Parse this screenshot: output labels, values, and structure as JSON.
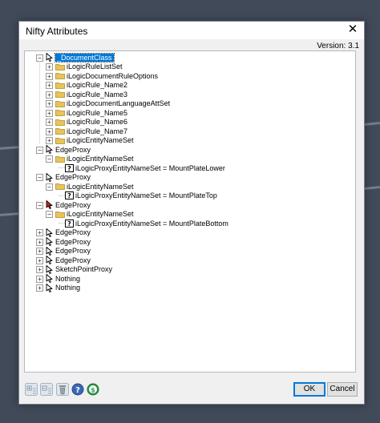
{
  "dialog": {
    "title": "Nifty Attributes",
    "close_symbol": "✕",
    "version": "Version: 3.1"
  },
  "tree": [
    {
      "level": 0,
      "expander": "−",
      "icon": "cursor-icon",
      "label": "_DocumentClass",
      "selected": true
    },
    {
      "level": 1,
      "expander": "+",
      "icon": "folder-icon",
      "label": "iLogicRuleListSet"
    },
    {
      "level": 1,
      "expander": "+",
      "icon": "folder-icon",
      "label": "iLogicDocumentRuleOptions"
    },
    {
      "level": 1,
      "expander": "+",
      "icon": "folder-icon",
      "label": "iLogicRule_Name2"
    },
    {
      "level": 1,
      "expander": "+",
      "icon": "folder-icon",
      "label": "iLogicRule_Name3"
    },
    {
      "level": 1,
      "expander": "+",
      "icon": "folder-icon",
      "label": "iLogicDocumentLanguageAttSet"
    },
    {
      "level": 1,
      "expander": "+",
      "icon": "folder-icon",
      "label": "iLogicRule_Name5"
    },
    {
      "level": 1,
      "expander": "+",
      "icon": "folder-icon",
      "label": "iLogicRule_Name6"
    },
    {
      "level": 1,
      "expander": "+",
      "icon": "folder-icon",
      "label": "iLogicRule_Name7"
    },
    {
      "level": 1,
      "expander": "+",
      "icon": "folder-icon",
      "label": "iLogicEntityNameSet"
    },
    {
      "level": 0,
      "expander": "−",
      "icon": "cursor-icon",
      "label": "EdgeProxy"
    },
    {
      "level": 1,
      "expander": "−",
      "icon": "folder-icon",
      "label": "iLogicEntityNameSet"
    },
    {
      "level": 2,
      "expander": "",
      "icon": "question-icon",
      "label": "iLogicProxyEntityNameSet = MountPlateLower"
    },
    {
      "level": 0,
      "expander": "−",
      "icon": "cursor-icon",
      "label": "EdgeProxy"
    },
    {
      "level": 1,
      "expander": "−",
      "icon": "folder-icon",
      "label": "iLogicEntityNameSet"
    },
    {
      "level": 2,
      "expander": "",
      "icon": "question-icon",
      "label": "iLogicProxyEntityNameSet = MountPlateTop"
    },
    {
      "level": 0,
      "expander": "−",
      "icon": "cursor-red-icon",
      "label": "EdgeProxy"
    },
    {
      "level": 1,
      "expander": "−",
      "icon": "folder-icon",
      "label": "iLogicEntityNameSet"
    },
    {
      "level": 2,
      "expander": "",
      "icon": "question-icon",
      "label": "iLogicProxyEntityNameSet = MountPlateBottom"
    },
    {
      "level": 0,
      "expander": "+",
      "icon": "cursor-icon",
      "label": "EdgeProxy"
    },
    {
      "level": 0,
      "expander": "+",
      "icon": "cursor-icon",
      "label": "EdgeProxy"
    },
    {
      "level": 0,
      "expander": "+",
      "icon": "cursor-icon",
      "label": "EdgeProxy"
    },
    {
      "level": 0,
      "expander": "+",
      "icon": "cursor-icon",
      "label": "EdgeProxy"
    },
    {
      "level": 0,
      "expander": "+",
      "icon": "cursor-icon",
      "label": "SketchPointProxy"
    },
    {
      "level": 0,
      "expander": "+",
      "icon": "cursor-icon",
      "label": "Nothing"
    },
    {
      "level": 0,
      "expander": "+",
      "icon": "cursor-icon",
      "label": "Nothing"
    }
  ],
  "toolbar": [
    {
      "name": "expand-all-icon"
    },
    {
      "name": "collapse-all-icon"
    },
    {
      "name": "delete-icon"
    },
    {
      "name": "help-icon"
    },
    {
      "name": "donate-icon"
    }
  ],
  "buttons": {
    "ok": "OK",
    "cancel": "Cancel"
  },
  "colors": {
    "selection": "#0078d7",
    "folder": "#e8c45a",
    "background": "#414a59"
  }
}
